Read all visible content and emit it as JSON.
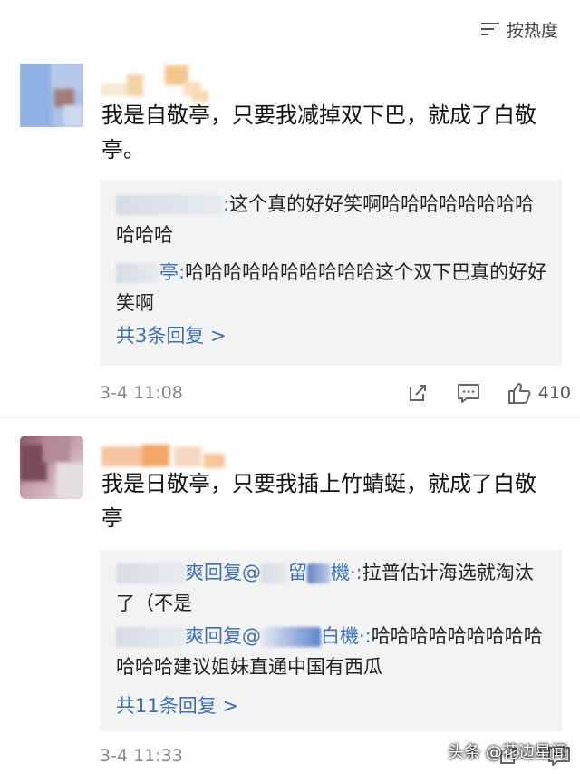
{
  "sort": {
    "label": "按热度"
  },
  "comments": [
    {
      "text": "我是自敬亭，只要我减掉双下巴，就成了白敬亭。",
      "replies": [
        {
          "name_suffix": ":",
          "text": "这个真的好好笑啊哈哈哈哈哈哈哈哈哈哈哈"
        },
        {
          "name_suffix": "亭:",
          "text": "哈哈哈哈哈哈哈哈哈哈这个双下巴真的好好笑啊"
        }
      ],
      "more": "共3条回复 >",
      "time": "3-4 11:08",
      "likes": "410"
    },
    {
      "text": "我是日敬亭，只要我插上竹蜻蜓，就成了白敬亭",
      "replies": [
        {
          "name_part": "爽回复@",
          "name_part2": "留",
          "name_part3": "機·:",
          "text": "拉普估计海选就淘汰了（不是"
        },
        {
          "name_part": "爽回复@",
          "name_part3": "白機·:",
          "text": "哈哈哈哈哈哈哈哈哈哈哈哈建议姐妹直通中国有西瓜"
        }
      ],
      "more": "共11条回复 >",
      "time": "3-4 11:33",
      "likes": ""
    }
  ],
  "watermark": "头条 @花边星闻"
}
